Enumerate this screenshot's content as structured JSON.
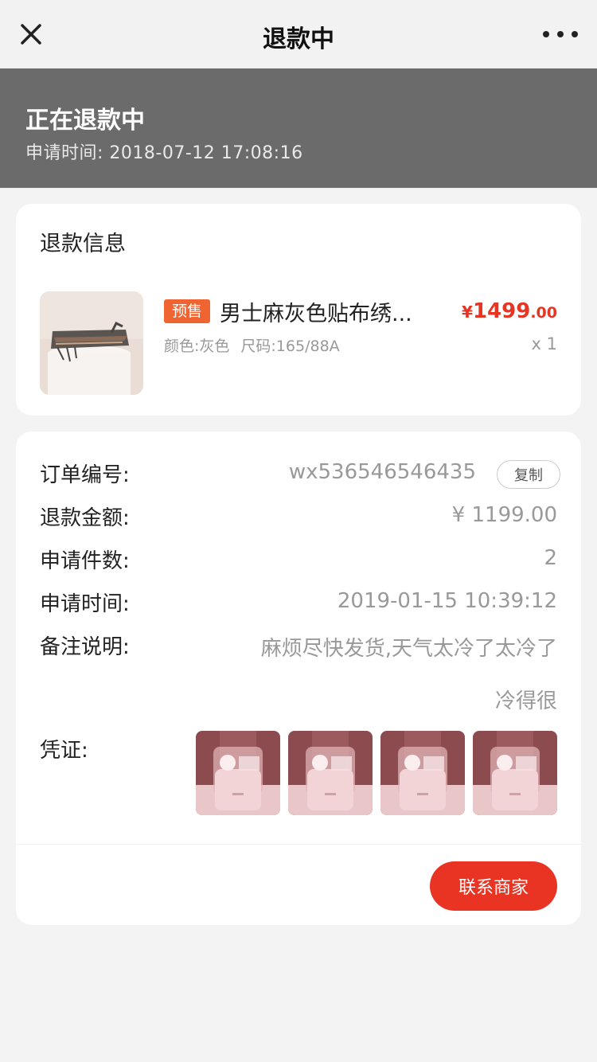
{
  "navbar": {
    "title": "退款中"
  },
  "status": {
    "title": "正在退款中",
    "time_label": "申请时间:",
    "time_value": "2018-07-12 17:08:16"
  },
  "refund_info": {
    "section_title": "退款信息",
    "product": {
      "badge": "预售",
      "name": "男士麻灰色贴布绣...",
      "price_symbol": "¥",
      "price_int": "1499",
      "price_dec": ".00",
      "spec_color": "颜色:灰色",
      "spec_size": "尺码:165/88A",
      "qty": "x 1"
    }
  },
  "order": {
    "order_no_label": "订单编号:",
    "order_no": "wx536546546435",
    "copy_label": "复制",
    "amount_label": "退款金额:",
    "amount": "¥ 1199.00",
    "count_label": "申请件数:",
    "count": "2",
    "time_label": "申请时间:",
    "time": "2019-01-15 10:39:12",
    "note_label": "备注说明:",
    "note_line1": "麻烦尽快发货,天气太冷了太冷了",
    "note_line2": "冷得很",
    "proof_label": "凭证:",
    "proof_count": 4
  },
  "actions": {
    "contact": "联系商家"
  },
  "colors": {
    "accent": "#e93323",
    "badge": "#f06432",
    "header": "#6b6b6b"
  }
}
